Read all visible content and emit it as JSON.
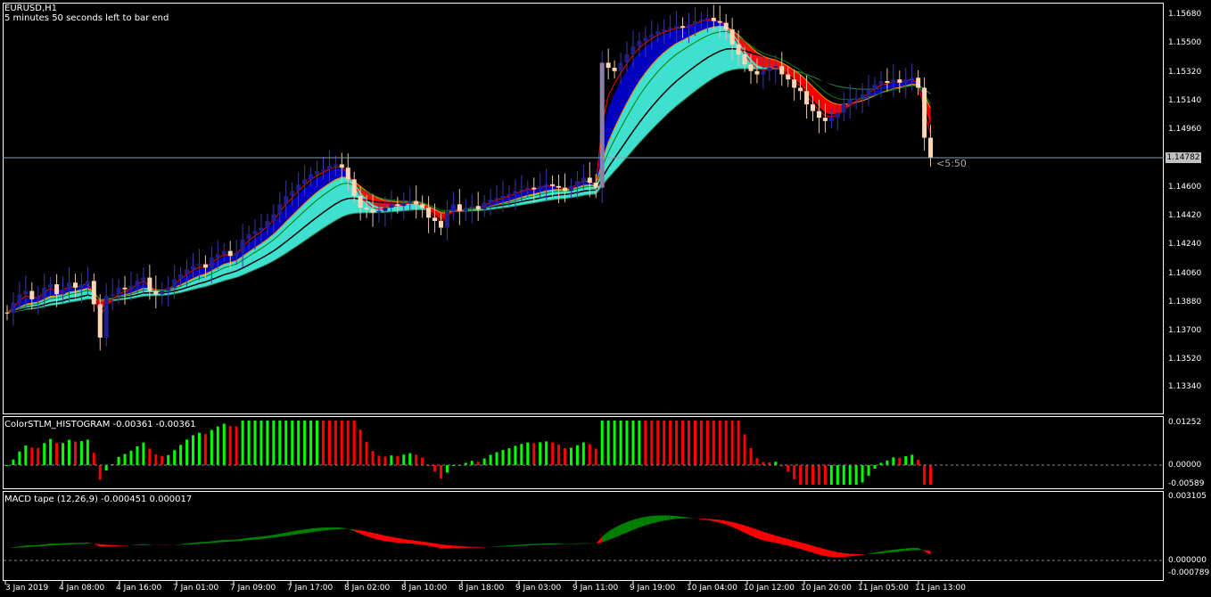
{
  "window": {
    "symbol": "EURUSD,H1",
    "timer_note": "5 minutes 50 seconds left to bar end",
    "bar_timer": "<5:50",
    "current_price": "1.14782"
  },
  "price_axis": {
    "ticks": [
      "1.15680",
      "1.15500",
      "1.15320",
      "1.15140",
      "1.14960",
      "1.14782",
      "1.14600",
      "1.14420",
      "1.14240",
      "1.14060",
      "1.13880",
      "1.13700",
      "1.13520",
      "1.13340"
    ],
    "range": [
      1.1325,
      1.157
    ]
  },
  "time_axis": {
    "labels": [
      "3 Jan 2019",
      "4 Jan 08:00",
      "4 Jan 16:00",
      "7 Jan 01:00",
      "7 Jan 09:00",
      "7 Jan 17:00",
      "8 Jan 02:00",
      "8 Jan 10:00",
      "8 Jan 18:00",
      "9 Jan 03:00",
      "9 Jan 11:00",
      "9 Jan 19:00",
      "10 Jan 04:00",
      "10 Jan 12:00",
      "10 Jan 20:00",
      "11 Jan 05:00",
      "11 Jan 13:00"
    ]
  },
  "histogram_panel": {
    "title": "ColorSTLM_HISTOGRAM -0.00361 -0.00361",
    "ticks": [
      "0.01252",
      "0.00000",
      "-0.00589"
    ]
  },
  "macd_panel": {
    "title": "MACD tape (12,26,9) -0.000451 0.000017",
    "ticks": [
      "0.003105",
      "0.000000",
      "-0.000789"
    ]
  },
  "colors": {
    "background": "#000000",
    "bull_candle": "#1f1f8f",
    "bear_candle": "#ffd7b4",
    "doji_candle": "#8c7da7",
    "cloud_fill": "#40e0d0",
    "band_blue": "#0000cd",
    "band_red": "#ff0000",
    "band_orange": "#ff8c00",
    "hist_up": "#00ff00",
    "hist_down": "#ff0000",
    "macd_up": "#008000",
    "macd_down": "#ff0000"
  },
  "chart_data": {
    "type": "candlestick",
    "title": "EURUSD,H1",
    "ylim": [
      1.1325,
      1.157
    ],
    "closes": [
      1.1385,
      1.1391,
      1.1396,
      1.1398,
      1.1393,
      1.1394,
      1.14,
      1.1402,
      1.1396,
      1.1399,
      1.1403,
      1.14,
      1.1402,
      1.1404,
      1.139,
      1.137,
      1.1395,
      1.1396,
      1.14,
      1.1399,
      1.1401,
      1.1404,
      1.1406,
      1.1398,
      1.1396,
      1.1398,
      1.14,
      1.1405,
      1.1408,
      1.1411,
      1.1413,
      1.1414,
      1.1412,
      1.1418,
      1.142,
      1.1422,
      1.1419,
      1.1421,
      1.1429,
      1.1432,
      1.1434,
      1.1436,
      1.144,
      1.1444,
      1.145,
      1.1455,
      1.1458,
      1.1462,
      1.1465,
      1.1468,
      1.147,
      1.1471,
      1.1473,
      1.1474,
      1.1472,
      1.1465,
      1.1455,
      1.1448,
      1.1447,
      1.1445,
      1.1446,
      1.1448,
      1.145,
      1.1449,
      1.1451,
      1.1452,
      1.145,
      1.1448,
      1.1442,
      1.144,
      1.1436,
      1.1446,
      1.145,
      1.1446,
      1.1448,
      1.1449,
      1.1447,
      1.1451,
      1.1453,
      1.1454,
      1.1455,
      1.1456,
      1.1458,
      1.1459,
      1.146,
      1.1459,
      1.1461,
      1.1462,
      1.1461,
      1.146,
      1.1458,
      1.1461,
      1.1464,
      1.1466,
      1.1463,
      1.146,
      1.1535,
      1.1532,
      1.153,
      1.1535,
      1.154,
      1.1545,
      1.1548,
      1.155,
      1.1552,
      1.1554,
      1.1555,
      1.1556,
      1.1557,
      1.1556,
      1.1558,
      1.156,
      1.1561,
      1.1562,
      1.156,
      1.1559,
      1.1555,
      1.1546,
      1.154,
      1.1534,
      1.153,
      1.1528,
      1.153,
      1.1532,
      1.1533,
      1.1528,
      1.1525,
      1.152,
      1.1518,
      1.151,
      1.1506,
      1.1502,
      1.15,
      1.1502,
      1.1505,
      1.151,
      1.1513,
      1.1514,
      1.1516,
      1.1519,
      1.1522,
      1.1524,
      1.1523,
      1.1525,
      1.1523,
      1.1525,
      1.1526,
      1.152,
      1.149,
      1.1478
    ]
  }
}
